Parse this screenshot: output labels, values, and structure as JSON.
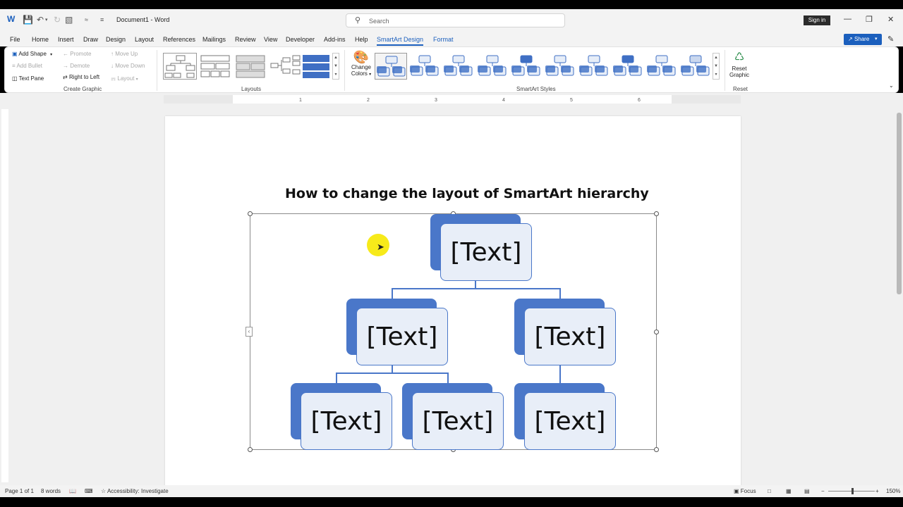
{
  "titlebar": {
    "app_title": "Document1  -  Word",
    "search_placeholder": "Search",
    "signin_label": "Sign in",
    "icons": [
      "word-logo-icon",
      "save-icon",
      "undo-icon",
      "redo-icon",
      "format-icon",
      "customize-icon"
    ]
  },
  "menu": {
    "tabs": [
      "File",
      "Home",
      "Insert",
      "Draw",
      "Design",
      "Layout",
      "References",
      "Mailings",
      "Review",
      "View",
      "Developer",
      "Add-ins",
      "Help"
    ],
    "context_tabs": [
      "SmartArt Design",
      "Format"
    ],
    "active_tab": "SmartArt Design",
    "share_label": "Share"
  },
  "ribbon": {
    "create_graphic": {
      "label": "Create Graphic",
      "add_shape": "Add Shape",
      "add_bullet": "Add Bullet",
      "text_pane": "Text Pane",
      "promote": "Promote",
      "demote": "Demote",
      "right_to_left": "Right to Left",
      "move_up": "Move Up",
      "move_down": "Move Down",
      "layout": "Layout"
    },
    "layouts_label": "Layouts",
    "change_colors": [
      "Change",
      "Colors"
    ],
    "smartart_styles_label": "SmartArt Styles",
    "reset": {
      "label": "Reset",
      "reset_graphic": [
        "Reset",
        "Graphic"
      ]
    }
  },
  "document": {
    "heading": "How to change the layout of SmartArt hierarchy",
    "nodes": [
      "[Text]",
      "[Text]",
      "[Text]",
      "[Text]",
      "[Text]",
      "[Text]"
    ]
  },
  "ruler_numbers": [
    "1",
    "2",
    "3",
    "4",
    "5",
    "6"
  ],
  "statusbar": {
    "page": "Page 1 of 1",
    "words": "8 words",
    "accessibility": "Accessibility: Investigate",
    "focus": "Focus",
    "zoom": "150%"
  },
  "colors": {
    "accent": "#1b5fbd",
    "smartart_fill": "#4a77c9",
    "smartart_node": "#e8eef8",
    "cursor_highlight": "#f7ea1a"
  }
}
